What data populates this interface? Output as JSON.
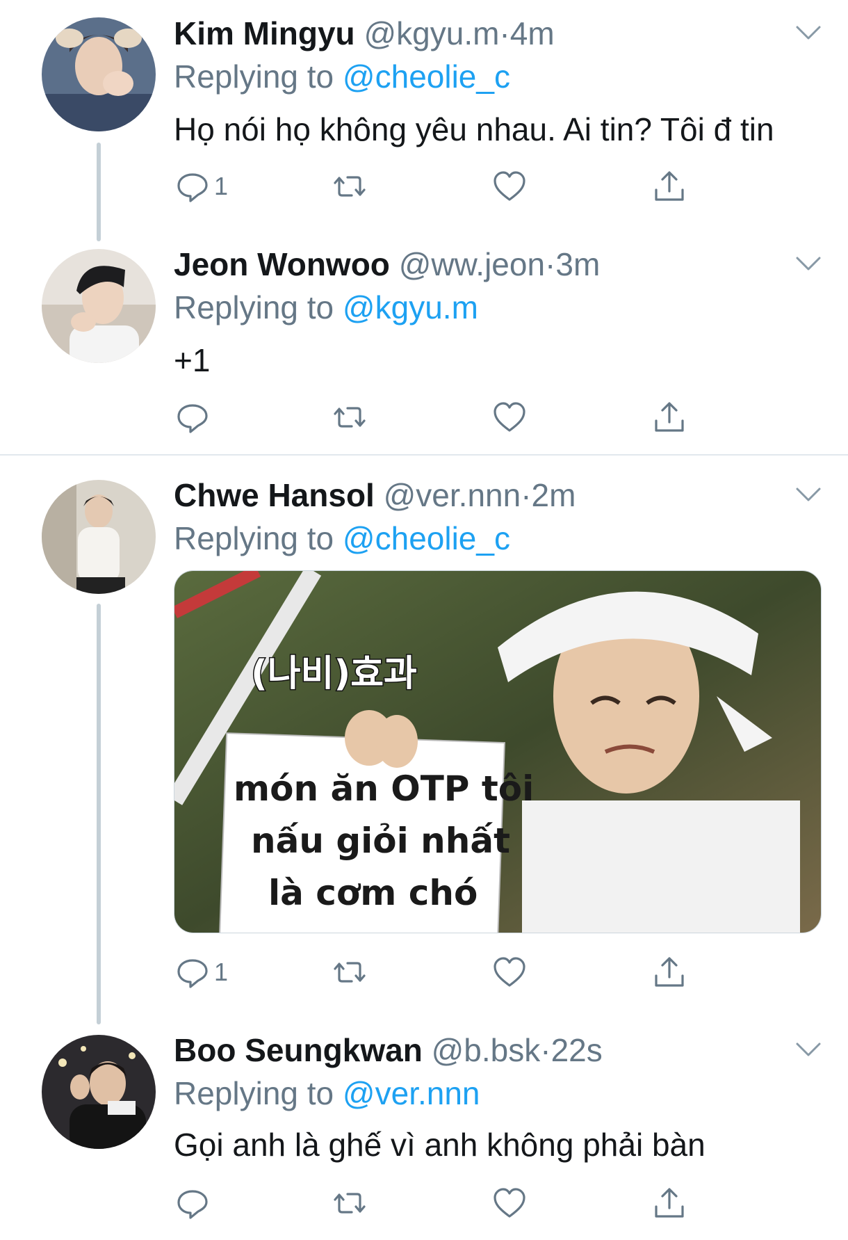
{
  "tweets": [
    {
      "name": "Kim Mingyu",
      "handle": "@kgyu.m",
      "dot": "·",
      "time": "4m",
      "replying_prefix": "Replying to",
      "replying_to": "@cheolie_c",
      "text": "Họ nói họ không yêu nhau. Ai tin? Tôi đ tin",
      "reply_count": "1"
    },
    {
      "name": "Jeon Wonwoo",
      "handle": "@ww.jeon",
      "dot": "·",
      "time": "3m",
      "replying_prefix": "Replying to",
      "replying_to": "@kgyu.m",
      "text": "+1",
      "reply_count": ""
    },
    {
      "name": "Chwe Hansol",
      "handle": "@ver.nnn",
      "dot": "·",
      "time": "2m",
      "replying_prefix": "Replying to",
      "replying_to": "@cheolie_c",
      "media": {
        "caption_korean": "(나비)효과",
        "sign_line1": "món ăn OTP tôi",
        "sign_line2": "nấu giỏi nhất",
        "sign_line3": "là cơm chó"
      },
      "reply_count": "1"
    },
    {
      "name": "Boo Seungkwan",
      "handle": "@b.bsk",
      "dot": "·",
      "time": "22s",
      "replying_prefix": "Replying to",
      "replying_to": "@ver.nnn",
      "text": "Gọi anh là ghế vì anh không phải bàn",
      "reply_count": ""
    }
  ],
  "icons": [
    "reply-icon",
    "retweet-icon",
    "like-icon",
    "share-icon",
    "chevron-down-icon"
  ],
  "colors": {
    "link": "#1da1f2",
    "secondary": "#657786",
    "divider": "#e1e8ed",
    "thread": "#c4cfd6"
  }
}
